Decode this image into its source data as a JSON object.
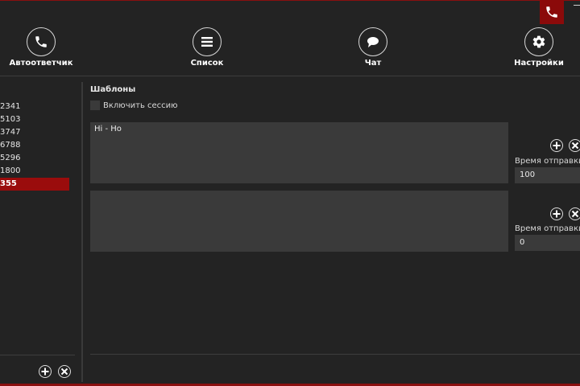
{
  "nav": [
    {
      "label": "Автоответчик",
      "icon": "phone-icon"
    },
    {
      "label": "Список",
      "icon": "list-icon"
    },
    {
      "label": "Чат",
      "icon": "chat-bubble-icon"
    },
    {
      "label": "Настройки",
      "icon": "gear-icon"
    }
  ],
  "sidebar": {
    "items": [
      "2341",
      "5103",
      "3747",
      "6788",
      "5296",
      "1800",
      "355"
    ],
    "selected_index": 6
  },
  "templates": {
    "title": "Шаблоны",
    "session_checkbox_label": "Включить сессию",
    "session_checked": false,
    "items": [
      {
        "text": "Hi - Ho",
        "send_time_label": "Время отправки (в",
        "send_time_value": "100"
      },
      {
        "text": "",
        "send_time_label": "Время отправки (в",
        "send_time_value": "0"
      }
    ]
  },
  "colors": {
    "accent": "#8b0a0a",
    "background": "#232323",
    "field": "#3a3a3a"
  }
}
